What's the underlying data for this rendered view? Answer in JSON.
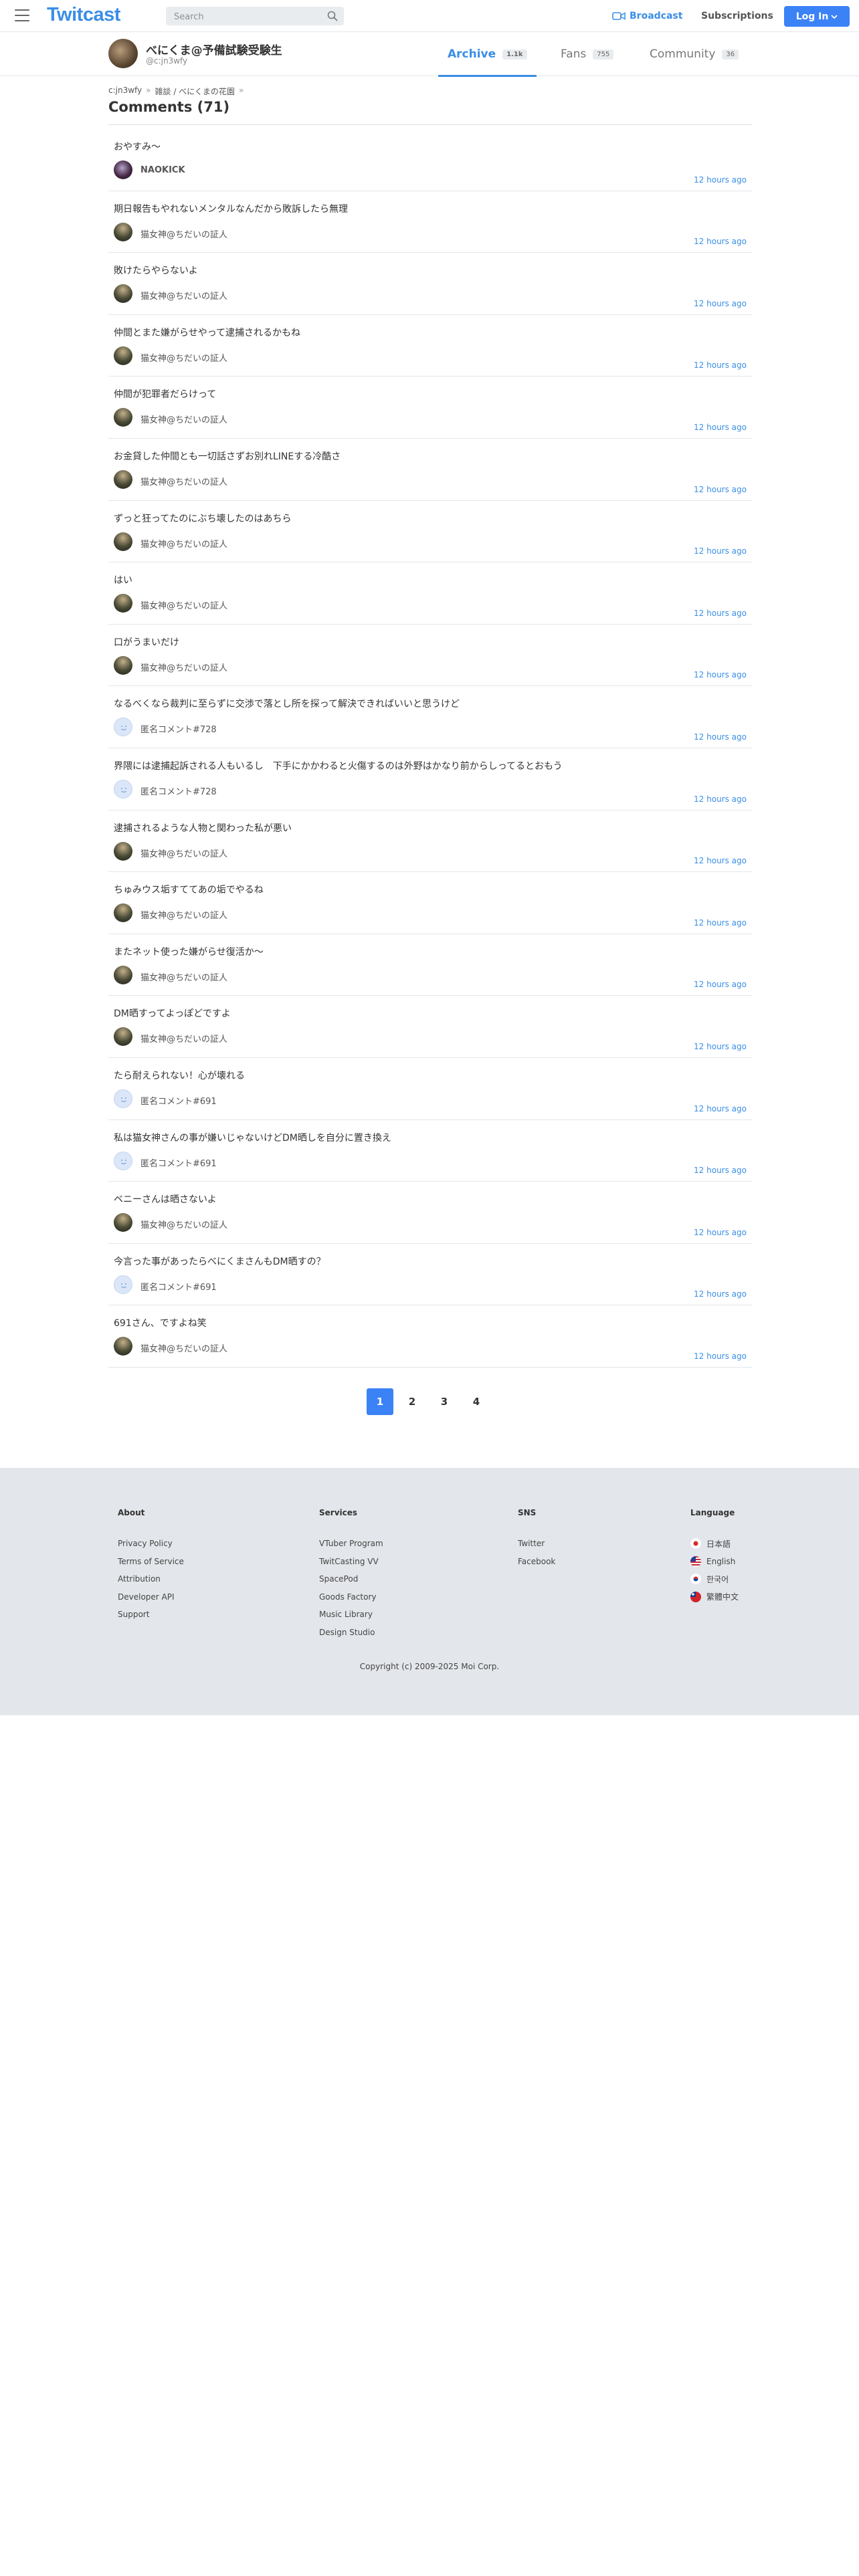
{
  "header": {
    "logo": "Twitcast",
    "search_placeholder": "Search",
    "broadcast": "Broadcast",
    "subscriptions": "Subscriptions",
    "login": "Log In"
  },
  "profile": {
    "name": "べにくま@予備試験受験生",
    "id": "@c:jn3wfy",
    "tabs": [
      {
        "label": "Archive",
        "count": "1.1k"
      },
      {
        "label": "Fans",
        "count": "755"
      },
      {
        "label": "Community",
        "count": "36"
      }
    ]
  },
  "breadcrumb": [
    "c:jn3wfy",
    "雑談 / べにくまの花園"
  ],
  "title": "Comments (71)",
  "comments": [
    {
      "text": "おやすみ〜",
      "user": "NAOKICK",
      "time": "12 hours ago",
      "avatar": "naokick"
    },
    {
      "text": "期日報告もやれないメンタルなんだから敗訴したら無理",
      "user": "猫女神@ちだいの証人",
      "time": "12 hours ago",
      "avatar": "chara"
    },
    {
      "text": "敗けたらやらないよ",
      "user": "猫女神@ちだいの証人",
      "time": "12 hours ago",
      "avatar": "chara"
    },
    {
      "text": "仲間とまた嫌がらせやって逮捕されるかもね",
      "user": "猫女神@ちだいの証人",
      "time": "12 hours ago",
      "avatar": "chara"
    },
    {
      "text": "仲間が犯罪者だらけって",
      "user": "猫女神@ちだいの証人",
      "time": "12 hours ago",
      "avatar": "chara"
    },
    {
      "text": "お金貸した仲間とも一切話さずお別れLINEする冷酷さ",
      "user": "猫女神@ちだいの証人",
      "time": "12 hours ago",
      "avatar": "chara"
    },
    {
      "text": "ずっと狂ってたのにぶち壊したのはあちら",
      "user": "猫女神@ちだいの証人",
      "time": "12 hours ago",
      "avatar": "chara"
    },
    {
      "text": "はい",
      "user": "猫女神@ちだいの証人",
      "time": "12 hours ago",
      "avatar": "chara"
    },
    {
      "text": "口がうまいだけ",
      "user": "猫女神@ちだいの証人",
      "time": "12 hours ago",
      "avatar": "chara"
    },
    {
      "text": "なるべくなら裁判に至らずに交渉で落とし所を探って解決できればいいと思うけど",
      "user": "匿名コメント#728",
      "time": "12 hours ago",
      "avatar": "anon"
    },
    {
      "text": "界隈には逮捕起訴される人もいるし　下手にかかわると火傷するのは外野はかなり前からしってるとおもう",
      "user": "匿名コメント#728",
      "time": "12 hours ago",
      "avatar": "anon"
    },
    {
      "text": "逮捕されるような人物と関わった私が悪い",
      "user": "猫女神@ちだいの証人",
      "time": "12 hours ago",
      "avatar": "chara"
    },
    {
      "text": "ちゅみウス垢すててあの垢でやるね",
      "user": "猫女神@ちだいの証人",
      "time": "12 hours ago",
      "avatar": "chara"
    },
    {
      "text": "またネット使った嫌がらせ復活か〜",
      "user": "猫女神@ちだいの証人",
      "time": "12 hours ago",
      "avatar": "chara"
    },
    {
      "text": "DM晒すってよっぽどですよ",
      "user": "猫女神@ちだいの証人",
      "time": "12 hours ago",
      "avatar": "chara"
    },
    {
      "text": "たら耐えられない！心が壊れる",
      "user": "匿名コメント#691",
      "time": "12 hours ago",
      "avatar": "anon"
    },
    {
      "text": "私は猫女神さんの事が嫌いじゃないけどDM晒しを自分に置き換え",
      "user": "匿名コメント#691",
      "time": "12 hours ago",
      "avatar": "anon"
    },
    {
      "text": "ベニーさんは晒さないよ",
      "user": "猫女神@ちだいの証人",
      "time": "12 hours ago",
      "avatar": "chara"
    },
    {
      "text": "今言った事があったらべにくまさんもDM晒すの？",
      "user": "匿名コメント#691",
      "time": "12 hours ago",
      "avatar": "anon"
    },
    {
      "text": "691さん、ですよね笑",
      "user": "猫女神@ちだいの証人",
      "time": "12 hours ago",
      "avatar": "chara"
    }
  ],
  "pagination": {
    "pages": [
      "1",
      "2",
      "3",
      "4"
    ],
    "current": "1"
  },
  "footer": {
    "about": {
      "heading": "About",
      "links": [
        "Privacy Policy",
        "Terms of Service",
        "Attribution",
        "Developer API",
        "Support"
      ]
    },
    "services": {
      "heading": "Services",
      "links": [
        "VTuber Program",
        "TwitCasting VV",
        "SpacePod",
        "Goods Factory",
        "Music Library",
        "Design Studio"
      ]
    },
    "sns": {
      "heading": "SNS",
      "links": [
        "Twitter",
        "Facebook"
      ]
    },
    "language": {
      "heading": "Language",
      "links": [
        "日本語",
        "English",
        "한국어",
        "繁體中文"
      ]
    },
    "copyright": "Copyright (c) 2009-2025 Moi Corp."
  },
  "colors": {
    "accent": "#3a8ee6",
    "button": "#3b82f6",
    "footer_bg": "#e3e6ea"
  }
}
